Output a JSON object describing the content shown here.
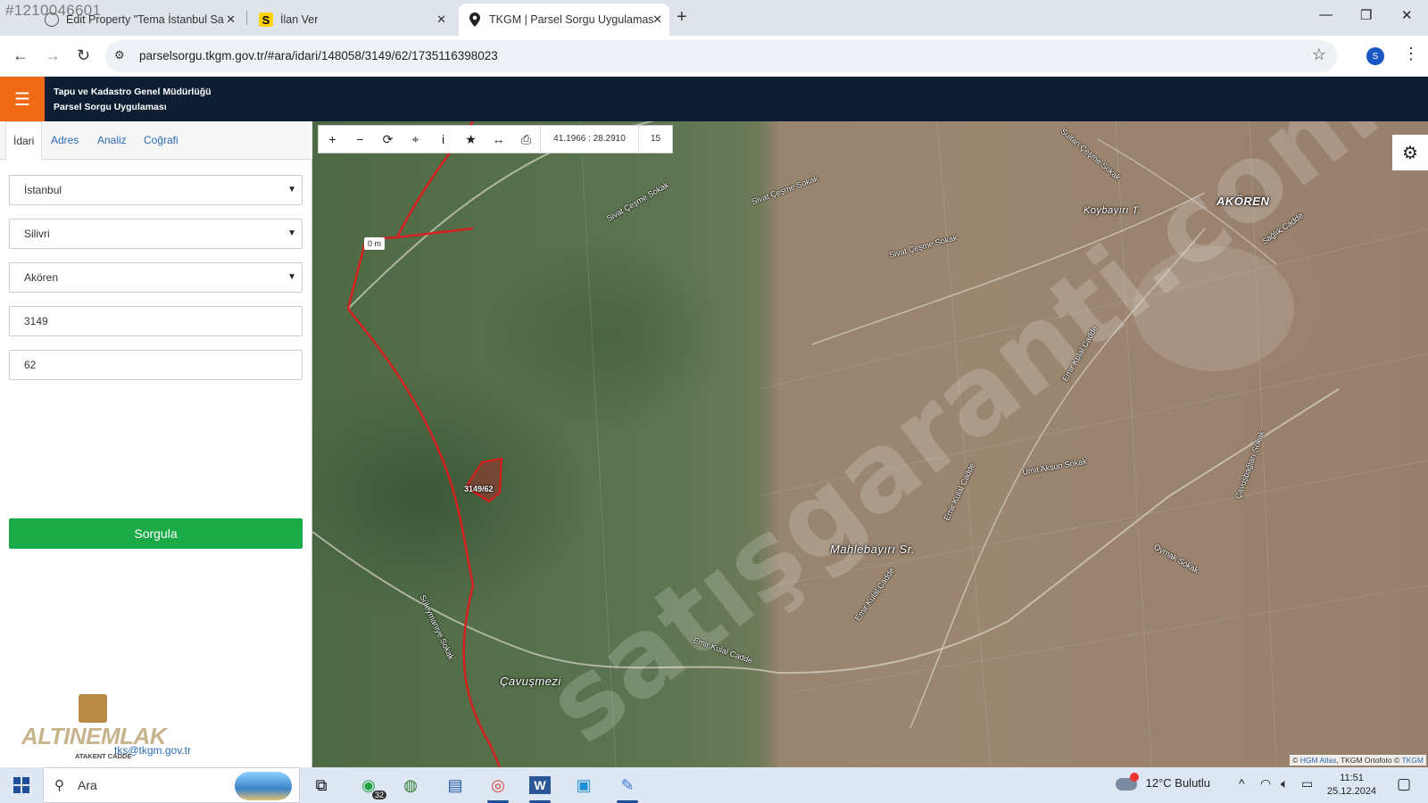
{
  "browser": {
    "overlay_id": "#1210046601",
    "tabs": [
      {
        "title": "Edit Property \"Tema İstanbul Sa",
        "icon": "globe-icon"
      },
      {
        "title": "İlan Ver",
        "icon": "sahibinden-s-icon"
      },
      {
        "title": "TKGM | Parsel Sorgu Uygulamas",
        "icon": "location-pin-icon",
        "active": true
      }
    ],
    "url": "parselsorgu.tkgm.gov.tr/#ara/idari/148058/3149/62/1735116398023",
    "profile_initial": "S"
  },
  "app": {
    "agency_line1": "Tapu ve Kadastro Genel Müdürlüğü",
    "agency_line2": "Parsel Sorgu Uygulaması"
  },
  "panel": {
    "tabs": [
      "İdari",
      "Adres",
      "Analiz",
      "Coğrafi"
    ],
    "active_tab": "İdari",
    "province": "İstanbul",
    "district": "Silivri",
    "neighborhood": "Akören",
    "block": "3149",
    "parcel": "62",
    "query_label": "Sorgula",
    "email_text": "tks@tkgm.gov.tr"
  },
  "logo": {
    "name": "ALTINEMLAK",
    "subtitle": "ATAKENT CADDE"
  },
  "map": {
    "coords": "41.1966 : 28.2910",
    "zoom": "15",
    "distance_label": "0 m",
    "parcel_label": "3149/62",
    "watermark": "satışgaranti.com",
    "attribution_prefix": "© ",
    "attribution_link1": "HGM Atlas",
    "attribution_mid": ", TKGM Ortofoto © ",
    "attribution_link2": "TKGM",
    "labels": {
      "village": "AKÖREN",
      "koybayiri": "Koybayırı T.",
      "mahlebayiri": "Mahlebayırı Sr.",
      "cavusmezi": "Çavuşmezi",
      "sivat1": "Sivat Çeşme Sokak",
      "sivat2": "Sivat Çeşme Sokak",
      "sivat3": "Sivat Çeşme Sokak",
      "sultan": "Sultan Çeşme Sokak",
      "emir1": "Emir Kulal Cadde",
      "emir2": "Emir Kulal Cadde",
      "emir3": "Emir Kulal Cadde",
      "emir4": "Emir Kulal Cadde",
      "suleymaniye": "Süleymaniye Sokak",
      "umit": "Ümit Aksun Sokak",
      "saglik": "Sağlık Cadde",
      "oymak": "Oymak Sokak",
      "cavu": "Çavuşbağları Sokak"
    }
  },
  "taskbar": {
    "search_placeholder": "Ara",
    "whatsapp_badge": "32",
    "weather": "12°C  Bulutlu",
    "time": "11:51",
    "date": "25.12.2024"
  }
}
